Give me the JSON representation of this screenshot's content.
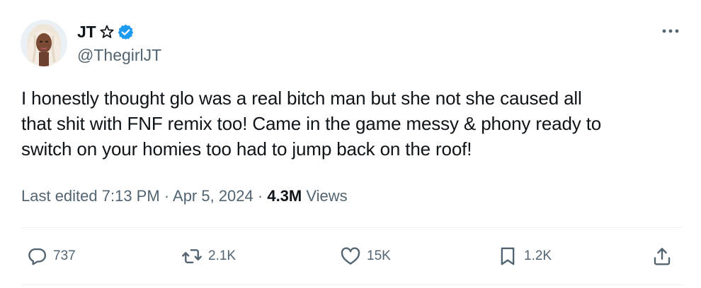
{
  "user": {
    "display_name": "JT",
    "handle": "@ThegirlJT"
  },
  "tweet": {
    "text": "I honestly thought glo was a real bitch man but she not she caused all\nthat shit with FNF remix too! Came in the game messy & phony ready to\nswitch on your homies too had to jump back on the roof!",
    "last_edited": "Last edited 7:13 PM · Apr 5, 2024 · ",
    "views_count": "4.3M",
    "views_label": " Views"
  },
  "actions": {
    "replies": "737",
    "reposts": "2.1K",
    "likes": "15K",
    "bookmarks": "1.2K"
  },
  "colors": {
    "verified": "#1d9bf0",
    "secondary_text": "#536471",
    "primary_text": "#0f1419",
    "divider": "#eff3f4"
  },
  "icons": {
    "star": "star-outline-icon",
    "verified": "verified-badge-icon",
    "more": "more-horizontal-icon",
    "reply": "reply-bubble-icon",
    "repost": "repost-arrows-icon",
    "like": "heart-icon",
    "bookmark": "bookmark-icon",
    "share": "share-upload-icon"
  }
}
